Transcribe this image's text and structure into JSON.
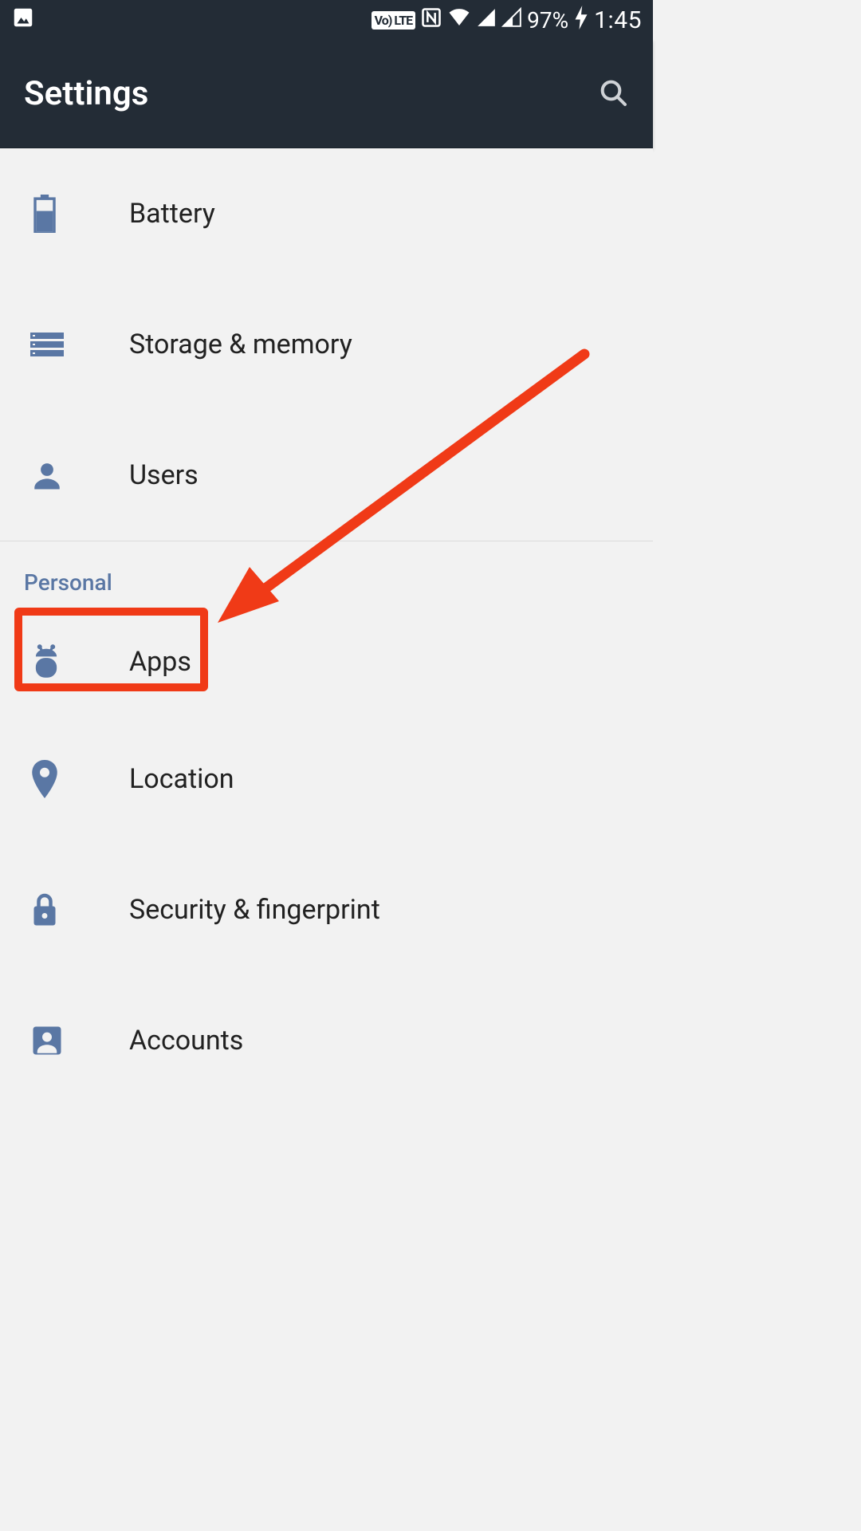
{
  "status": {
    "volte_label": "Vo) LTE",
    "battery_percent": "97%",
    "clock": "1:45"
  },
  "appbar": {
    "title": "Settings"
  },
  "rows": {
    "battery": "Battery",
    "storage": "Storage & memory",
    "users": "Users",
    "apps": "Apps",
    "location": "Location",
    "security": "Security & fingerprint",
    "accounts": "Accounts"
  },
  "sections": {
    "personal": "Personal"
  },
  "icon_color": "#5a77a4",
  "annotation_color": "#f03a17"
}
